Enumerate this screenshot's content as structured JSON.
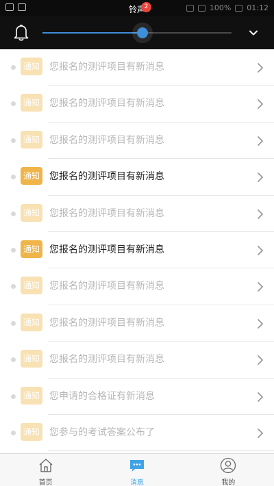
{
  "status_bar": {
    "title": "铃声",
    "battery_text": "100%",
    "time": "01:12"
  },
  "volume": {
    "level": 0.53,
    "accent_color": "#3f8ed8"
  },
  "messages": [
    {
      "tag": "通知",
      "text": "您报名的测评项目有新消息",
      "read": true
    },
    {
      "tag": "通知",
      "text": "您报名的测评项目有新消息",
      "read": true
    },
    {
      "tag": "通知",
      "text": "您报名的测评项目有新消息",
      "read": true
    },
    {
      "tag": "通知",
      "text": "您报名的测评项目有新消息",
      "read": false
    },
    {
      "tag": "通知",
      "text": "您报名的测评项目有新消息",
      "read": true
    },
    {
      "tag": "通知",
      "text": "您报名的测评项目有新消息",
      "read": false
    },
    {
      "tag": "通知",
      "text": "您报名的测评项目有新消息",
      "read": true
    },
    {
      "tag": "通知",
      "text": "您报名的测评项目有新消息",
      "read": true
    },
    {
      "tag": "通知",
      "text": "您报名的测评项目有新消息",
      "read": true
    },
    {
      "tag": "通知",
      "text": "您申请的合格证有新消息",
      "read": true
    },
    {
      "tag": "通知",
      "text": "您参与的考试答案公布了",
      "read": true
    }
  ],
  "tabbar": {
    "tabs": [
      {
        "label": "首页",
        "icon": "home-icon",
        "active": false
      },
      {
        "label": "消息",
        "icon": "chat-icon",
        "active": true
      },
      {
        "label": "我的",
        "icon": "user-icon",
        "active": false
      }
    ],
    "message_badge": "2"
  },
  "colors": {
    "tag_unread": "#efb54a",
    "tag_read": "#f8e1b3",
    "tab_active": "#3fa3e6",
    "badge": "#e8453c"
  }
}
